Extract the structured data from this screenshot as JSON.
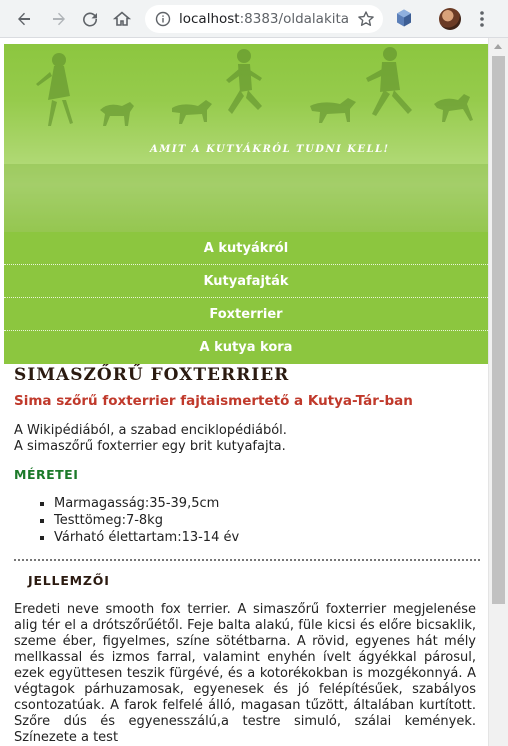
{
  "browser": {
    "url_host": "localhost",
    "url_rest": ":8383/oldalakita...",
    "icons": [
      "back-arrow-icon",
      "forward-arrow-icon",
      "reload-icon",
      "home-icon",
      "info-icon",
      "star-icon",
      "extension-icon",
      "avatar",
      "menu-icon"
    ]
  },
  "banner": {
    "tagline": "AMIT A KUTYÁKRÓL TUDNI KELL!",
    "colors": {
      "green": "#8cc63f",
      "silhouette": "#5a8a2a"
    }
  },
  "nav": {
    "items": [
      {
        "label": "A kutyákról"
      },
      {
        "label": "Kutyafajták"
      },
      {
        "label": "Foxterrier"
      },
      {
        "label": "A kutya kora"
      }
    ]
  },
  "article": {
    "title": "SIMASZŐRŰ FOXTERRIER",
    "subtitle": "Sima szőrű foxterrier fajtaismertető a Kutya-Tár-ban",
    "intro_line1": "A Wikipédiából, a szabad enciklopédiából.",
    "intro_line2": "A simaszőrű foxterrier egy brit kutyafajta.",
    "meretei_heading": "MÉRETEI",
    "meretei": [
      {
        "text": "Marmagasság:35-39,5cm"
      },
      {
        "text": "Testtömeg:7-8kg"
      },
      {
        "text": "Várható élettartam:13-14 év"
      }
    ],
    "jellemzoi_heading": "JELLEMZŐI",
    "jellemzoi_text": "Eredeti neve smooth fox terrier. A simaszőrű foxterrier megjelenése alig tér el a drótszőrűétől. Feje balta alakú, füle kicsi és előre bicsaklik, szeme éber, figyelmes, színe sötétbarna. A rövid, egyenes hát mély mellkassal és izmos farral, valamint enyhén ívelt ágyékkal párosul, ezek együttesen teszik fürgévé, és a kotorékokban is mozgékonnyá. A végtagok párhuzamosak, egyenesek és jó felépítésűek, szabályos csontozatúak. A farok felfelé álló, magasan tűzött, általában kurtított. Szőre dús és egyenesszálú,a testre simuló, szálai kemények. Színezete a test"
  }
}
